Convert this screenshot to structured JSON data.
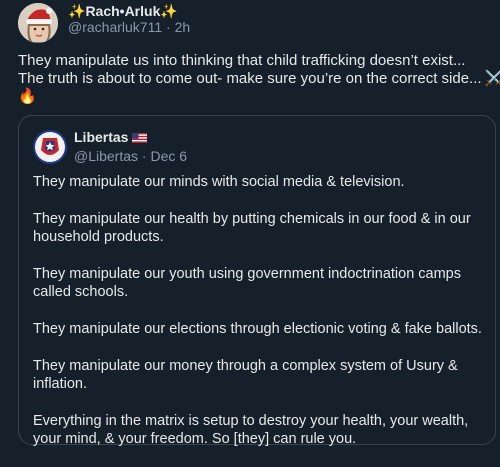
{
  "post": {
    "author": {
      "name": "Rach•Arluk",
      "handle": "@racharluk711",
      "time": "2h"
    },
    "text_line1": "They manipulate us into thinking that child trafficking doesn’t exist...",
    "text_line2": "The truth is about to come out- make sure you’re on the correct side...",
    "emojis": [
      "crossed-swords-icon",
      "fire-icon"
    ]
  },
  "quoted_post": {
    "author": {
      "name": "Libertas",
      "handle": "@Libertas",
      "date": "Dec 6"
    },
    "paragraphs": [
      "They manipulate our minds with social media & television.",
      "They manipulate our health by putting chemicals in our food & in our household products.",
      "They manipulate our youth using government indoctrination camps called schools.",
      "They manipulate our elections through electionic voting & fake ballots.",
      "They manipulate our money through a complex system of Usury & inflation.",
      "Everything in the matrix is setup to destroy your health, your wealth, your mind, & your freedom. So [they] can rule you."
    ]
  },
  "colors": {
    "background": "#15202b",
    "text": "#e7e9ea",
    "secondary_text": "#8b98a5",
    "border": "#38444d"
  }
}
